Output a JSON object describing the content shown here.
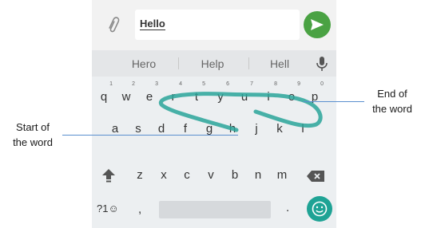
{
  "message_bar": {
    "input_value": "Hello",
    "attach_icon": "paperclip-icon",
    "send_icon": "send-icon",
    "send_color": "#4aa243"
  },
  "suggestions": {
    "items": [
      "Hero",
      "Help",
      "Hell"
    ],
    "mic_icon": "mic-icon"
  },
  "keyboard": {
    "row1": [
      {
        "key": "q",
        "hint": "1"
      },
      {
        "key": "w",
        "hint": "2"
      },
      {
        "key": "e",
        "hint": "3"
      },
      {
        "key": "r",
        "hint": "4"
      },
      {
        "key": "t",
        "hint": "5"
      },
      {
        "key": "y",
        "hint": "6"
      },
      {
        "key": "u",
        "hint": "7"
      },
      {
        "key": "i",
        "hint": "8"
      },
      {
        "key": "o",
        "hint": "9"
      },
      {
        "key": "p",
        "hint": "0"
      }
    ],
    "row2": [
      "a",
      "s",
      "d",
      "f",
      "g",
      "h",
      "j",
      "k",
      "l"
    ],
    "row3": [
      "z",
      "x",
      "c",
      "v",
      "b",
      "n",
      "m"
    ],
    "symbols_label": "?1☺",
    "comma_label": ",",
    "period_label": ".",
    "emoji_color": "#1fa395",
    "trail_color": "#2aa59a"
  },
  "annotations": {
    "start": "Start of\nthe word",
    "start_line1": "Start of",
    "start_line2": "the word",
    "end_line1": "End of",
    "end_line2": "the word",
    "line_color": "#5a8fcf"
  }
}
